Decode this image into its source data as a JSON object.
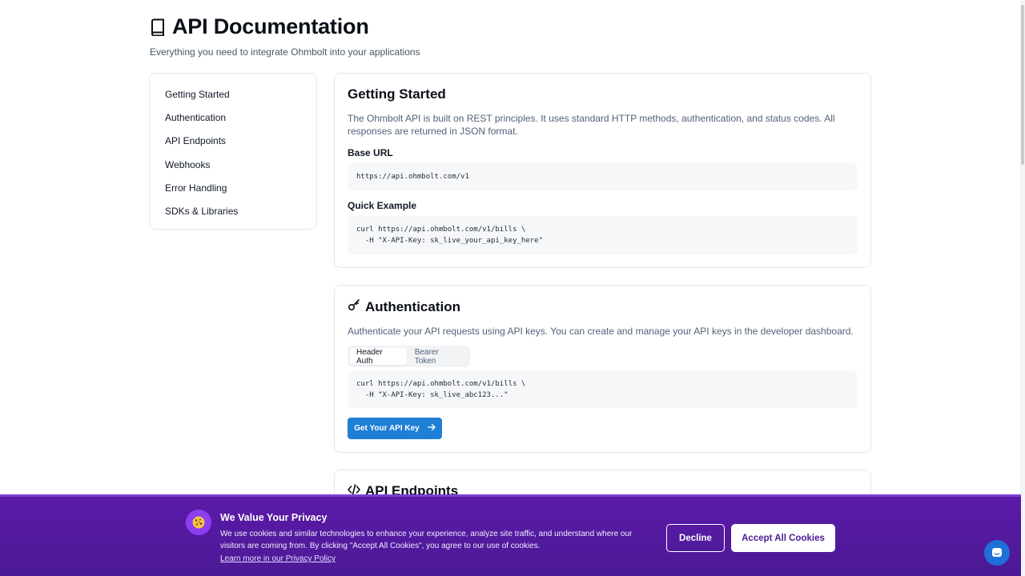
{
  "header": {
    "title": "API Documentation",
    "subtitle": "Everything you need to integrate Ohmbolt into your applications",
    "icon": "book-icon"
  },
  "sidebar": {
    "items": [
      {
        "label": "Getting Started"
      },
      {
        "label": "Authentication"
      },
      {
        "label": "API Endpoints"
      },
      {
        "label": "Webhooks"
      },
      {
        "label": "Error Handling"
      },
      {
        "label": "SDKs & Libraries"
      }
    ]
  },
  "getting_started": {
    "title": "Getting Started",
    "description": "The Ohmbolt API is built on REST principles. It uses standard HTTP methods, authentication, and status codes. All responses are returned in JSON format.",
    "base_url_label": "Base URL",
    "base_url": "https://api.ohmbolt.com/v1",
    "quick_example_label": "Quick Example",
    "quick_example_code": "curl https://api.ohmbolt.com/v1/bills \\\n  -H \"X-API-Key: sk_live_your_api_key_here\""
  },
  "authentication": {
    "title": "Authentication",
    "icon": "key-icon",
    "description": "Authenticate your API requests using API keys. You can create and manage your API keys in the developer dashboard.",
    "tabs": [
      {
        "label": "Header Auth",
        "active": true
      },
      {
        "label": "Bearer Token",
        "active": false
      }
    ],
    "code": "curl https://api.ohmbolt.com/v1/bills \\\n  -H \"X-API-Key: sk_live_abc123...\"",
    "button_label": "Get Your API Key",
    "button_icon": "arrow-right-icon"
  },
  "endpoints": {
    "title": "API Endpoints",
    "icon": "code-icon"
  },
  "cookie_banner": {
    "icon": "cookie-icon",
    "title": "We Value Your Privacy",
    "text": "We use cookies and similar technologies to enhance your experience, analyze site traffic, and understand where our visitors are coming from. By clicking \"Accept All Cookies\", you agree to our use of cookies.",
    "link": "Learn more in our Privacy Policy",
    "decline_label": "Decline",
    "accept_label": "Accept All Cookies"
  },
  "chat": {
    "icon": "chat-icon"
  },
  "colors": {
    "accent": "#1f7fd6",
    "banner": "#5b1aa8"
  }
}
